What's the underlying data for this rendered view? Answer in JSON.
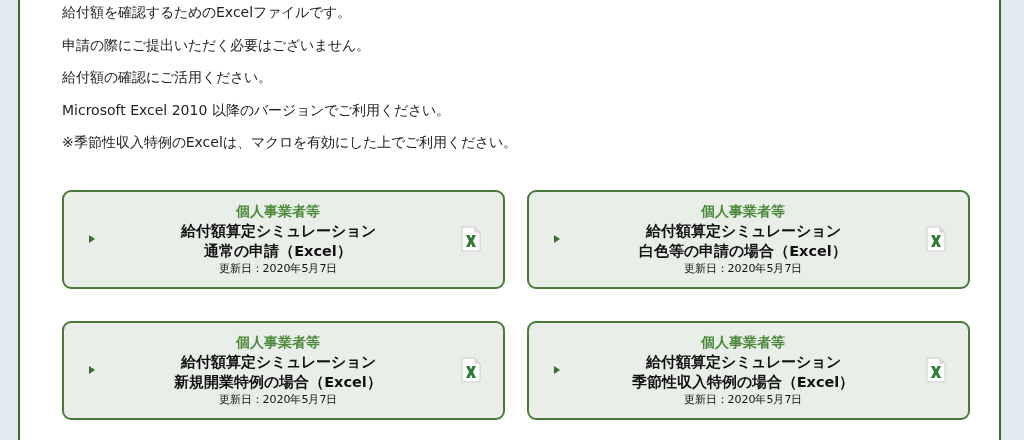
{
  "paragraphs": [
    "給付額を確認するためのExcelファイルです。",
    "申請の際にご提出いただく必要はございません。",
    "給付額の確認にご活用ください。",
    "Microsoft Excel 2010 以降のバージョンでご利用ください。",
    "※季節性収入特例のExcelは、マクロを有効にした上でご利用ください。"
  ],
  "downloads": [
    {
      "category": "個人事業者等",
      "title": "給付額算定シミュレーション",
      "subtitle": "通常の申請（Excel）",
      "updated": "更新日：2020年5月7日"
    },
    {
      "category": "個人事業者等",
      "title": "給付額算定シミュレーション",
      "subtitle": "白色等の申請の場合（Excel）",
      "updated": "更新日：2020年5月7日"
    },
    {
      "category": "個人事業者等",
      "title": "給付額算定シミュレーション",
      "subtitle": "新規開業特例の場合（Excel）",
      "updated": "更新日：2020年5月7日"
    },
    {
      "category": "個人事業者等",
      "title": "給付額算定シミュレーション",
      "subtitle": "季節性収入特例の場合（Excel）",
      "updated": "更新日：2020年5月7日"
    }
  ]
}
